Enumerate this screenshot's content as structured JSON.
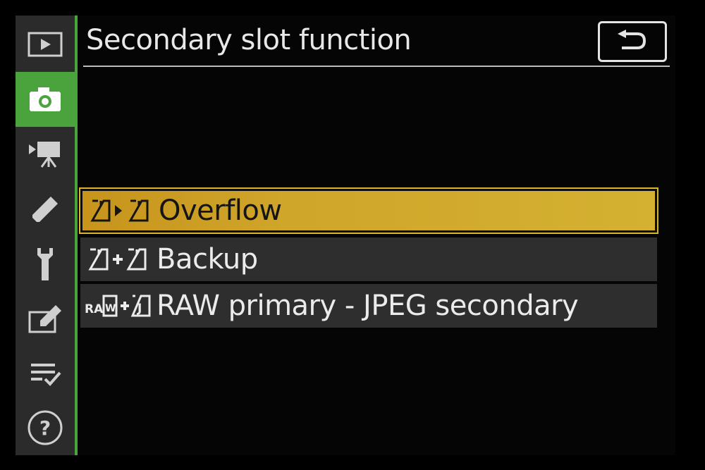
{
  "header": {
    "title": "Secondary slot function",
    "back_icon": "return-arrow-icon"
  },
  "sidebar": {
    "items": [
      {
        "icon": "playback-icon",
        "active": false
      },
      {
        "icon": "camera-icon",
        "active": true
      },
      {
        "icon": "movie-camera-icon",
        "active": false
      },
      {
        "icon": "pencil-icon",
        "active": false
      },
      {
        "icon": "wrench-icon",
        "active": false
      },
      {
        "icon": "retouch-icon",
        "active": false
      },
      {
        "icon": "my-menu-icon",
        "active": false
      },
      {
        "icon": "help-icon",
        "active": false
      }
    ],
    "active_color": "#4aa33c"
  },
  "options": [
    {
      "label": "Overflow",
      "icon": "overflow-slots-icon",
      "selected": true
    },
    {
      "label": "Backup",
      "icon": "backup-slots-icon",
      "selected": false
    },
    {
      "label": "RAW primary - JPEG secondary",
      "icon": "raw-jpeg-slots-icon",
      "selected": false
    }
  ],
  "colors": {
    "highlight": "#cfa52a",
    "row_bg": "#2e2e2e",
    "sidebar_bg": "#2b2b2b"
  }
}
